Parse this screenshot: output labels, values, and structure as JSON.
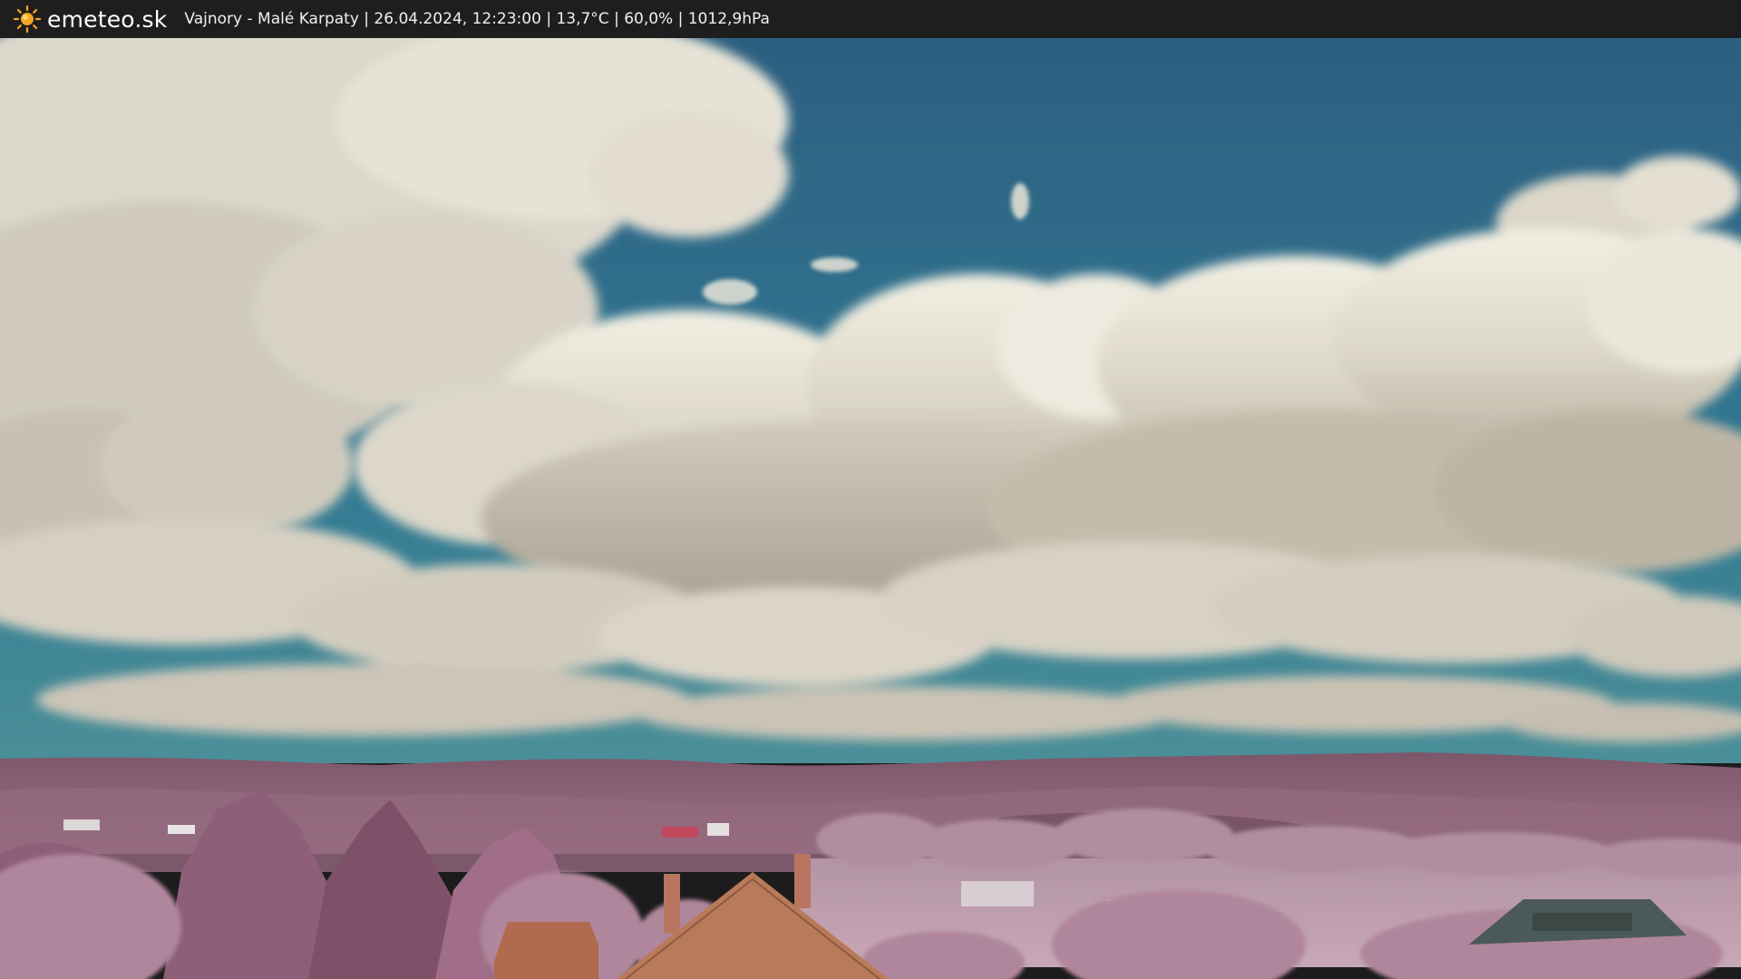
{
  "header": {
    "brand": "emeteo.sk",
    "logo_icon": "sun-icon",
    "status": "Vajnory - Malé Karpaty | 26.04.2024, 12:23:00 | 13,7°C | 60,0% | 1012,9hPa"
  },
  "colors": {
    "bar": "#1e1e1e",
    "sun": "#f5a623",
    "sky": "#2f6a8a",
    "cloud": "#e8e4d6",
    "hills": "#8a6278",
    "foliage": "#b48aa0",
    "roof": "#b06a4e"
  }
}
